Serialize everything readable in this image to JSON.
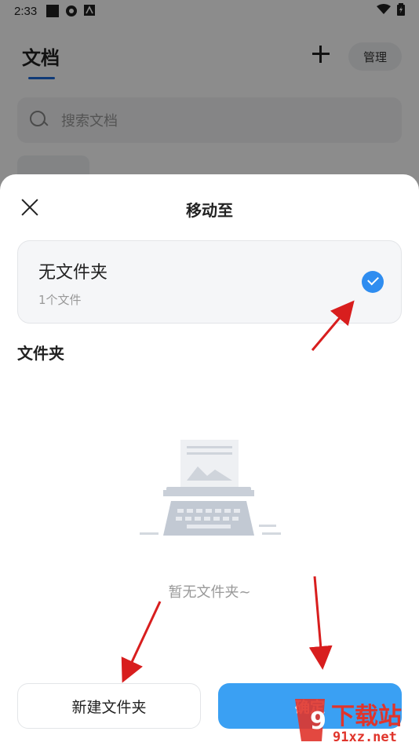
{
  "status_bar": {
    "time": "2:33"
  },
  "header": {
    "title": "文档",
    "manage_label": "管理"
  },
  "search": {
    "placeholder": "搜索文档"
  },
  "sheet": {
    "title": "移动至",
    "no_folder": {
      "title": "无文件夹",
      "subtitle": "1个文件"
    },
    "section_title": "文件夹",
    "empty_text": "暂无文件夹~",
    "new_folder_label": "新建文件夹",
    "confirm_label": "确定"
  },
  "watermark": {
    "text": "下载站",
    "domain": "91xz.net"
  },
  "colors": {
    "accent": "#3aa0f3",
    "check": "#2f8df0",
    "annotation_arrow": "#d81e1e"
  }
}
